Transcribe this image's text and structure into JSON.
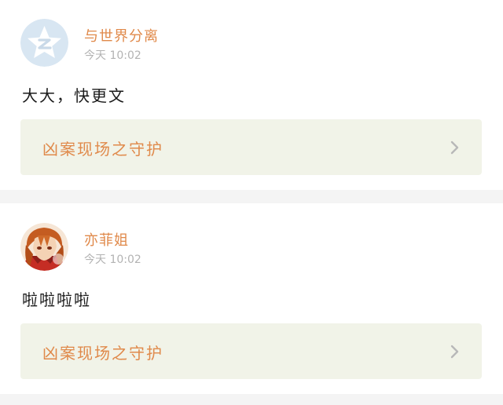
{
  "comments": [
    {
      "username": "与世界分离",
      "time": "今天 10:02",
      "text": "大大，快更文",
      "book_title": "凶案现场之守护",
      "avatar_icon": "qzone-default-avatar-icon"
    },
    {
      "username": "亦菲姐",
      "time": "今天 10:02",
      "text": "啦啦啦啦",
      "book_title": "凶案现场之守护",
      "avatar_icon": "anime-character-avatar"
    }
  ],
  "colors": {
    "username": "#e0894a",
    "timestamp": "#b3b3b3",
    "link_background": "#f1f3e8",
    "divider": "#f4f4f4"
  }
}
